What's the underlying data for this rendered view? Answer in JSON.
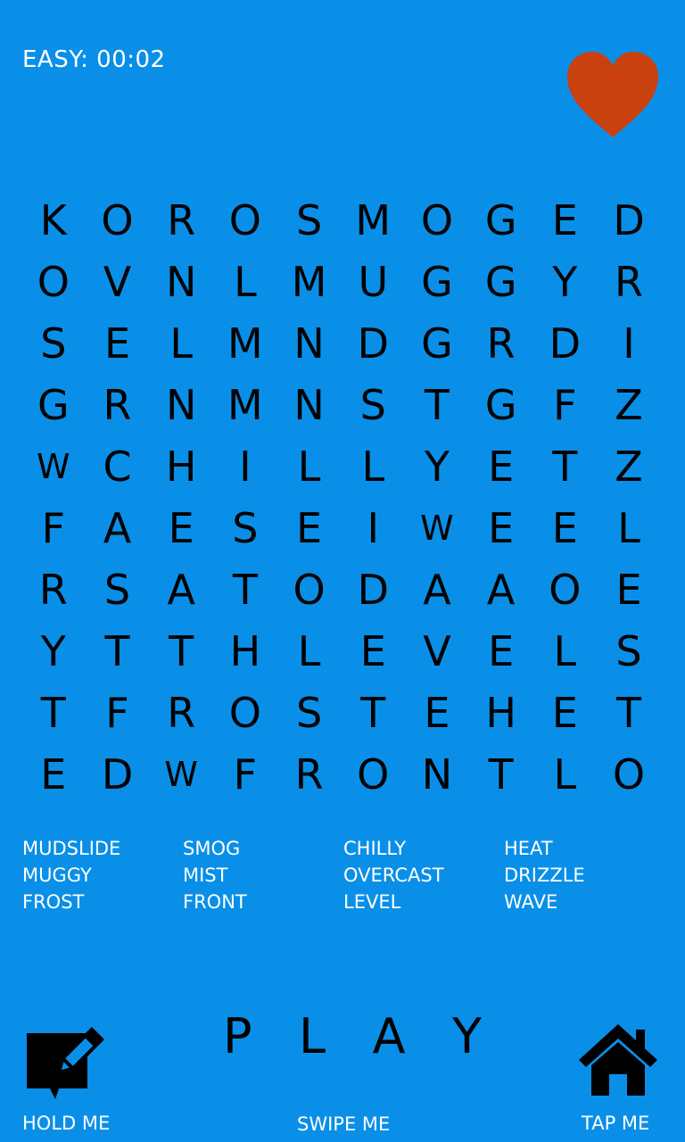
{
  "status": {
    "timer": "EASY: 00:02"
  },
  "colors": {
    "background": "#0a8fe8",
    "heart": "#c9410f"
  },
  "icons": {
    "heart": "heart-icon",
    "note": "edit-note-icon",
    "home": "home-icon"
  },
  "grid": [
    [
      "K",
      "O",
      "R",
      "O",
      "S",
      "M",
      "O",
      "G",
      "E",
      "D"
    ],
    [
      "O",
      "V",
      "N",
      "L",
      "M",
      "U",
      "G",
      "G",
      "Y",
      "R"
    ],
    [
      "S",
      "E",
      "L",
      "M",
      "N",
      "D",
      "G",
      "R",
      "D",
      "I"
    ],
    [
      "G",
      "R",
      "N",
      "M",
      "N",
      "S",
      "T",
      "G",
      "F",
      "Z"
    ],
    [
      "W",
      "C",
      "H",
      "I",
      "L",
      "L",
      "Y",
      "E",
      "T",
      "Z"
    ],
    [
      "F",
      "A",
      "E",
      "S",
      "E",
      "I",
      "W",
      "E",
      "E",
      "L"
    ],
    [
      "R",
      "S",
      "A",
      "T",
      "O",
      "D",
      "A",
      "A",
      "O",
      "E"
    ],
    [
      "Y",
      "T",
      "T",
      "H",
      "L",
      "E",
      "V",
      "E",
      "L",
      "S"
    ],
    [
      "T",
      "F",
      "R",
      "O",
      "S",
      "T",
      "E",
      "H",
      "E",
      "T"
    ],
    [
      "E",
      "D",
      "W",
      "F",
      "R",
      "O",
      "N",
      "T",
      "L",
      "O"
    ]
  ],
  "words": [
    "MUDSLIDE",
    "SMOG",
    "CHILLY",
    "HEAT",
    "MUGGY",
    "MIST",
    "OVERCAST",
    "DRIZZLE",
    "FROST",
    "FRONT",
    "LEVEL",
    "WAVE"
  ],
  "play": [
    "P",
    "L",
    "A",
    "Y"
  ],
  "controls": {
    "hold_label": "HOLD ME",
    "swipe_label": "SWIPE ME",
    "tap_label": "TAP ME"
  }
}
